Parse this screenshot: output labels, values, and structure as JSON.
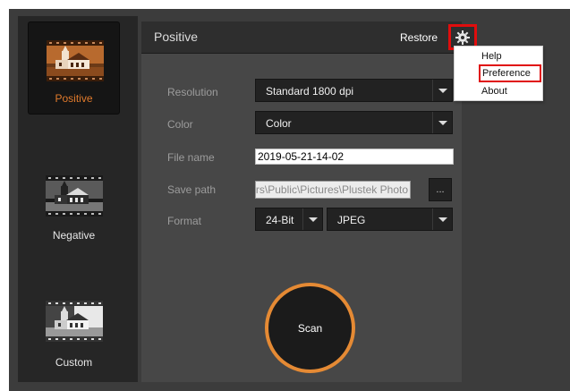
{
  "sidebar": {
    "modes": [
      {
        "label": "Positive",
        "active": true
      },
      {
        "label": "Negative",
        "active": false
      },
      {
        "label": "Custom",
        "active": false
      }
    ]
  },
  "panel": {
    "title": "Positive",
    "restore_label": "Restore",
    "gear_icon": "gear-icon",
    "fields": {
      "resolution": {
        "label": "Resolution",
        "value": "Standard 1800 dpi"
      },
      "color": {
        "label": "Color",
        "value": "Color"
      },
      "file_name": {
        "label": "File name",
        "value": "2019-05-21-14-02"
      },
      "save_path": {
        "label": "Save path",
        "value": "C:\\Users\\Public\\Pictures\\Plustek Photo",
        "browse_label": "..."
      },
      "format": {
        "label": "Format",
        "bit_depth": "24-Bit",
        "file_type": "JPEG"
      }
    },
    "scan_label": "Scan"
  },
  "settings_menu": {
    "items": [
      "Help",
      "Preference",
      "About"
    ],
    "highlighted": "Preference"
  },
  "colors": {
    "accent_orange": "#e58a34",
    "highlight_red": "#e00d0d",
    "panel_bg": "#474747",
    "sidebar_bg": "#262626"
  }
}
